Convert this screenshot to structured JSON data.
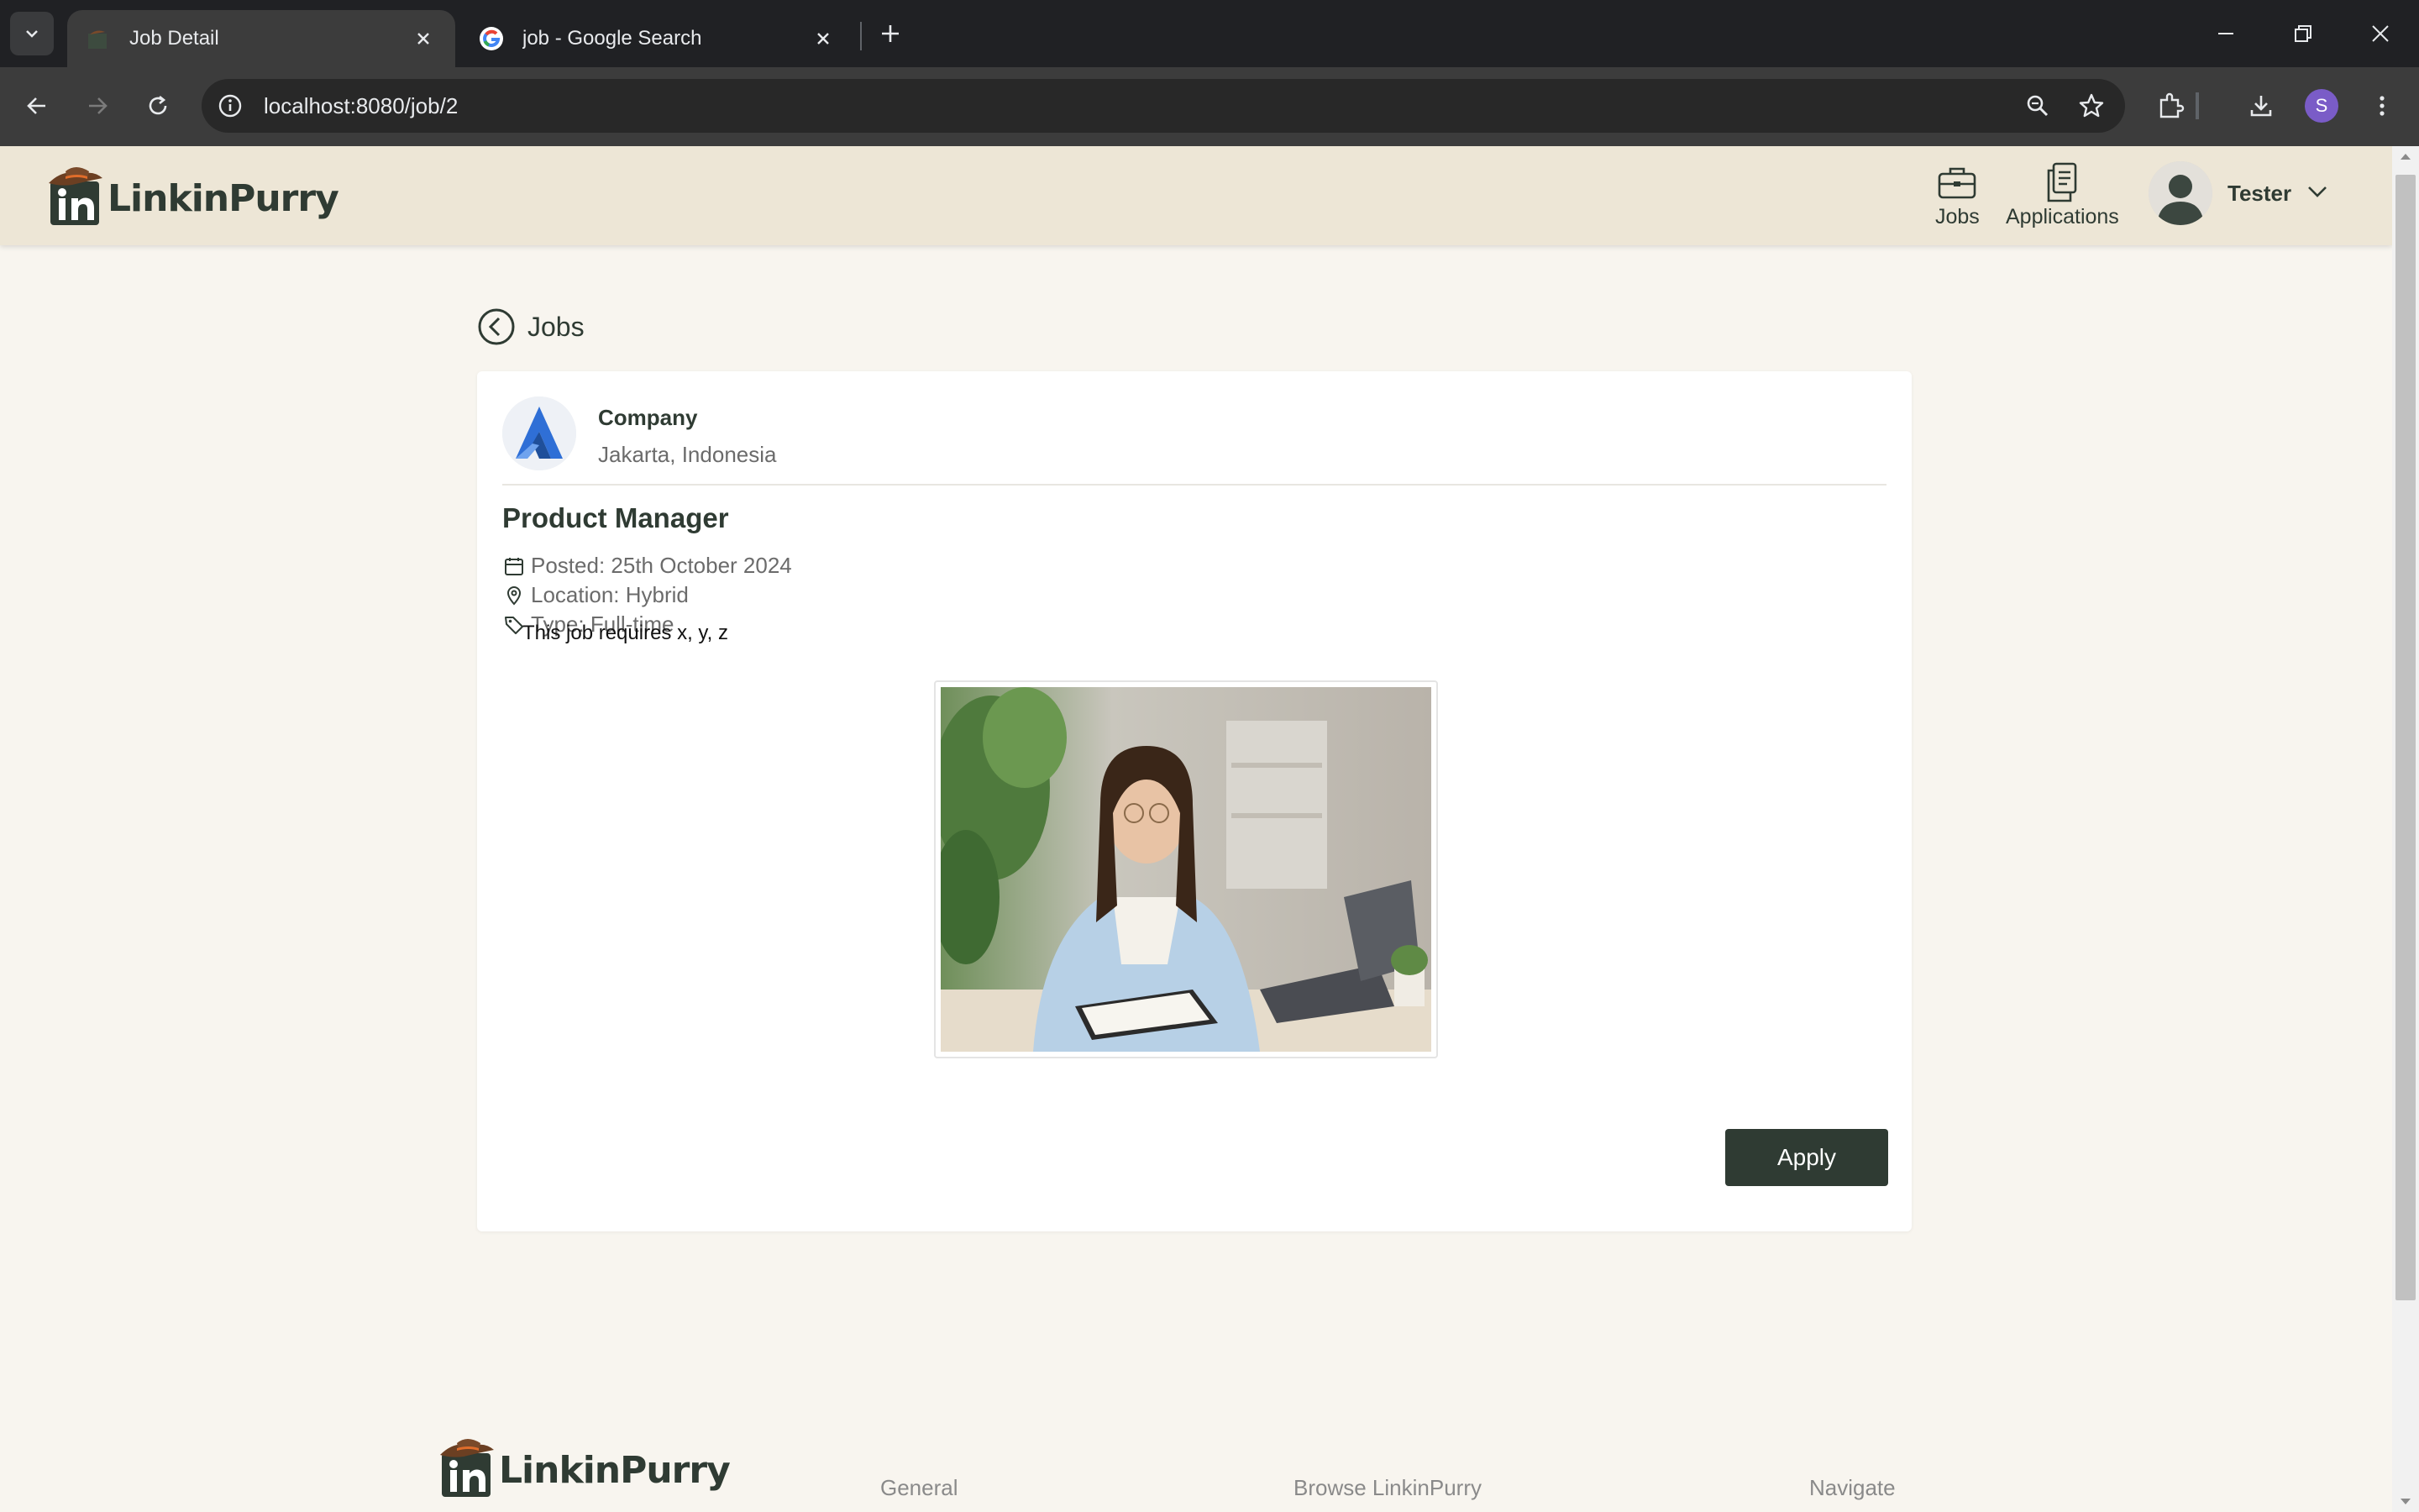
{
  "browser": {
    "tabs": [
      {
        "title": "Job Detail",
        "active": true
      },
      {
        "title": "job - Google Search",
        "active": false
      }
    ],
    "url": "localhost:8080/job/2",
    "profile_initial": "S"
  },
  "header": {
    "brand": "LinkinPurry",
    "nav": [
      {
        "label": "Jobs",
        "icon": "briefcase-icon"
      },
      {
        "label": "Applications",
        "icon": "documents-icon"
      }
    ],
    "user_name": "Tester"
  },
  "back_label": "Jobs",
  "job": {
    "company_name": "Company",
    "company_location": "Jakarta, Indonesia",
    "title": "Product Manager",
    "posted": "Posted: 25th October 2024",
    "location": "Location: Hybrid",
    "type": "Type: Full-time",
    "description": "This job requires x, y, z",
    "apply_label": "Apply"
  },
  "footer": {
    "brand": "LinkinPurry",
    "columns": [
      "General",
      "Browse LinkinPurry",
      "Navigate"
    ]
  },
  "colors": {
    "brand_dark": "#2f3b33",
    "header_bg": "#ede6d6",
    "page_bg": "#f8f5ef",
    "accent_orange": "#e06d2b"
  }
}
